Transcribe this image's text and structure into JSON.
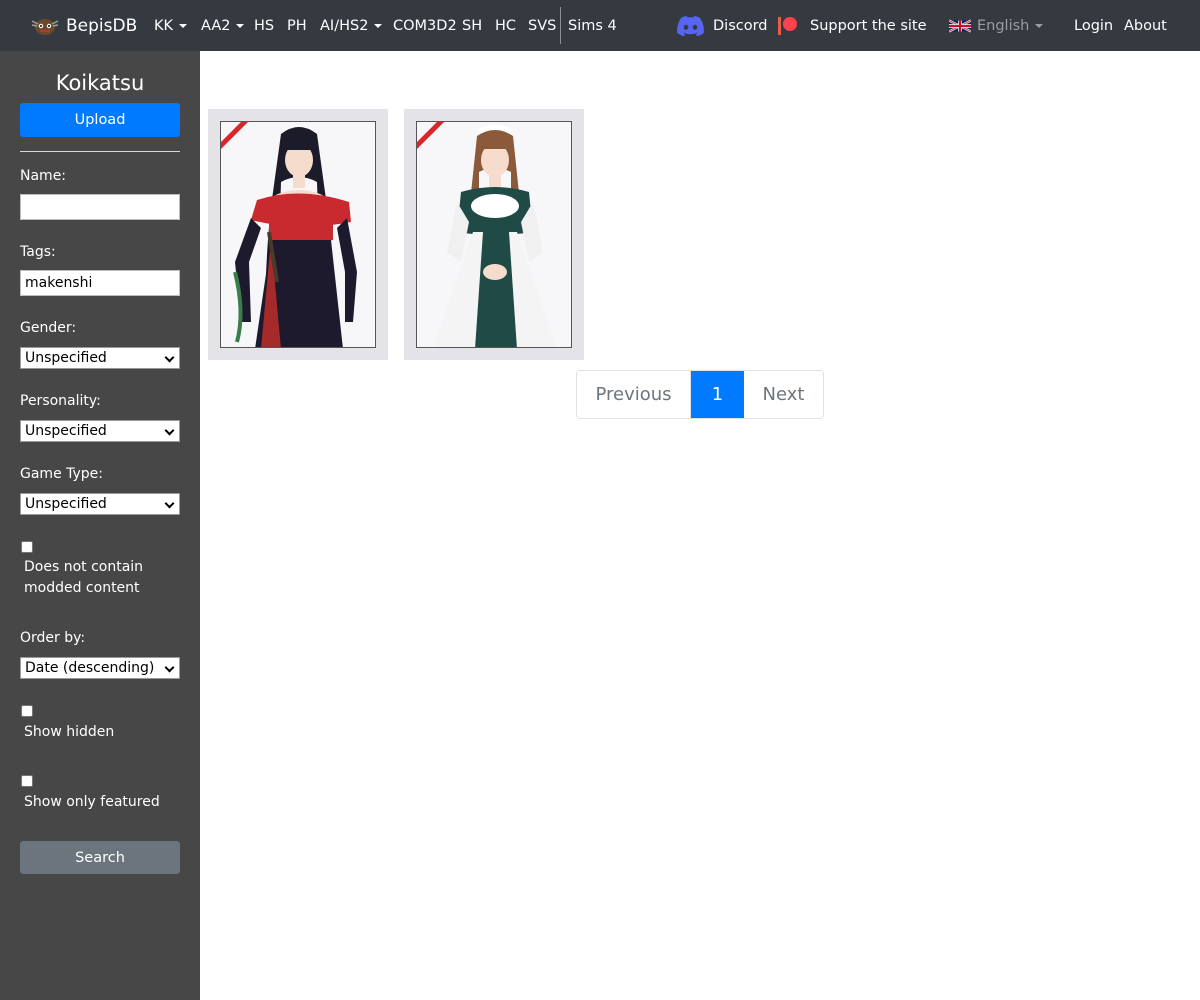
{
  "navbar": {
    "brand": "BepisDB",
    "menu": [
      {
        "label": "KK",
        "dropdown": true
      },
      {
        "label": "AA2",
        "dropdown": true
      },
      {
        "label": "HS",
        "dropdown": false
      },
      {
        "label": "PH",
        "dropdown": false
      },
      {
        "label": "AI/HS2",
        "dropdown": true
      },
      {
        "label": "COM3D2",
        "dropdown": false
      },
      {
        "label": "SH",
        "dropdown": false
      },
      {
        "label": "HC",
        "dropdown": false
      },
      {
        "label": "SVS",
        "dropdown": false
      },
      {
        "label": "Sims 4",
        "dropdown": false
      }
    ],
    "discord": "Discord",
    "support": "Support the site",
    "language": "English",
    "login": "Login",
    "about": "About"
  },
  "sidebar": {
    "title": "Koikatsu",
    "upload_label": "Upload",
    "name_label": "Name:",
    "name_value": "",
    "tags_label": "Tags:",
    "tags_value": "makenshi",
    "gender_label": "Gender:",
    "gender_value": "Unspecified",
    "personality_label": "Personality:",
    "personality_value": "Unspecified",
    "gametype_label": "Game Type:",
    "gametype_value": "Unspecified",
    "no_modded_label": "Does not contain modded content",
    "order_label": "Order by:",
    "order_value": "Date (descending)",
    "show_hidden_label": "Show hidden",
    "show_featured_label": "Show only featured",
    "search_label": "Search"
  },
  "pagination": {
    "previous": "Previous",
    "current": "1",
    "next": "Next"
  },
  "colors": {
    "navbar_bg": "#343a40",
    "sidebar_bg": "#474747",
    "primary": "#007bff",
    "secondary": "#6c757d",
    "discord": "#5865f2",
    "patreon": "#f96854"
  }
}
